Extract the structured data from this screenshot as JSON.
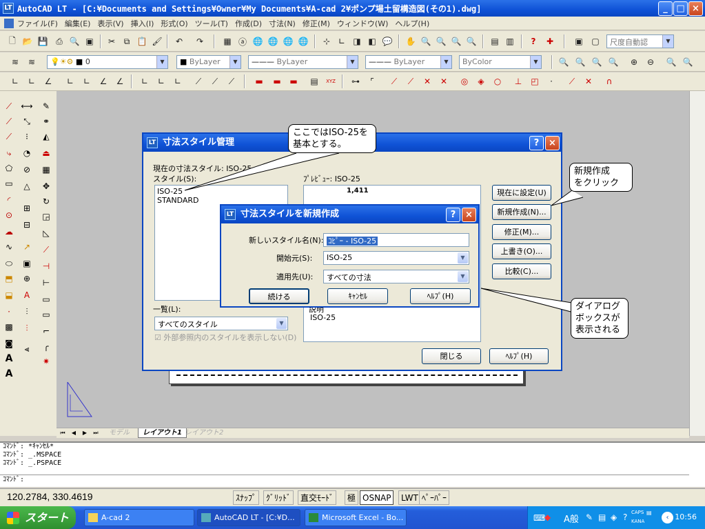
{
  "window": {
    "title": "AutoCAD LT - [C:¥Documents and Settings¥Owner¥My Documents¥A-cad 2¥ポンプ場土留構造図(その1).dwg]"
  },
  "menubar": [
    "ファイル(F)",
    "編集(E)",
    "表示(V)",
    "挿入(I)",
    "形式(O)",
    "ツール(T)",
    "作成(D)",
    "寸法(N)",
    "修正(M)",
    "ウィンドウ(W)",
    "ヘルプ(H)"
  ],
  "toolbar": {
    "scale_combo": "尺度自動認",
    "layer_combo": "0",
    "color_combo": "ByLayer",
    "linetype_combo": "ByLayer",
    "lineweight_combo": "ByLayer",
    "plotstyle_combo": "ByColor"
  },
  "layout_tabs": [
    "モデル",
    "レイアウト1",
    "レイアウト2"
  ],
  "command": {
    "lines": [
      "ｺﾏﾝﾄﾞ: *ｷｬﾝｾﾙ*",
      "ｺﾏﾝﾄﾞ: _.MSPACE",
      "ｺﾏﾝﾄﾞ: _.PSPACE"
    ],
    "prompt": "ｺﾏﾝﾄﾞ:"
  },
  "status": {
    "coords": "120.2784, 330.4619",
    "buttons": [
      "ｽﾅｯﾌﾟ",
      "ｸﾞﾘｯﾄﾞ",
      "直交ﾓｰﾄﾞ",
      "極",
      "OSNAP",
      "LWT",
      "ﾍﾟｰﾊﾟｰ"
    ]
  },
  "taskbar": {
    "start": "スタート",
    "tasks": [
      "A-cad 2",
      "AutoCAD LT - [C:¥D...",
      "Microsoft Excel - Bo..."
    ],
    "ime": "A般",
    "caps": "CAPS",
    "kana": "KANA",
    "clock": "10:56"
  },
  "dim_style_dialog": {
    "title": "寸法スタイル管理",
    "current_style": "現在の寸法スタイル: ISO-25",
    "styles_label": "スタイル(S):",
    "styles": [
      "ISO-25",
      "STANDARD"
    ],
    "preview_label": "ﾌﾟﾚﾋﾞｭｰ: ISO-25",
    "preview_dim": "1,411",
    "list_label": "一覧(L):",
    "list_value": "すべてのスタイル",
    "xref_checkbox": "外部参照内のスタイルを表示しない(D)",
    "desc_label": "説明",
    "desc_value": "ISO-25",
    "btn_set_current": "現在に設定(U)",
    "btn_new": "新規作成(N)...",
    "btn_modify": "修正(M)...",
    "btn_override": "上書き(O)...",
    "btn_compare": "比較(C)...",
    "btn_close": "閉じる",
    "btn_help": "ﾍﾙﾌﾟ(H)"
  },
  "new_style_dialog": {
    "title": "寸法スタイルを新規作成",
    "name_label": "新しいスタイル名(N):",
    "name_value": "ｺﾋﾟｰ - ISO-25",
    "start_label": "開始元(S):",
    "start_value": "ISO-25",
    "use_label": "適用先(U):",
    "use_value": "すべての寸法",
    "btn_continue": "続ける",
    "btn_cancel": "ｷｬﾝｾﾙ",
    "btn_help": "ﾍﾙﾌﾟ(H)"
  },
  "callouts": {
    "iso": [
      "ここではISO-25を",
      "基本とする。"
    ],
    "new": [
      "新規作成",
      "をクリック"
    ],
    "dialog": [
      "ダイアログ",
      "ボックスが",
      "表示される"
    ]
  }
}
